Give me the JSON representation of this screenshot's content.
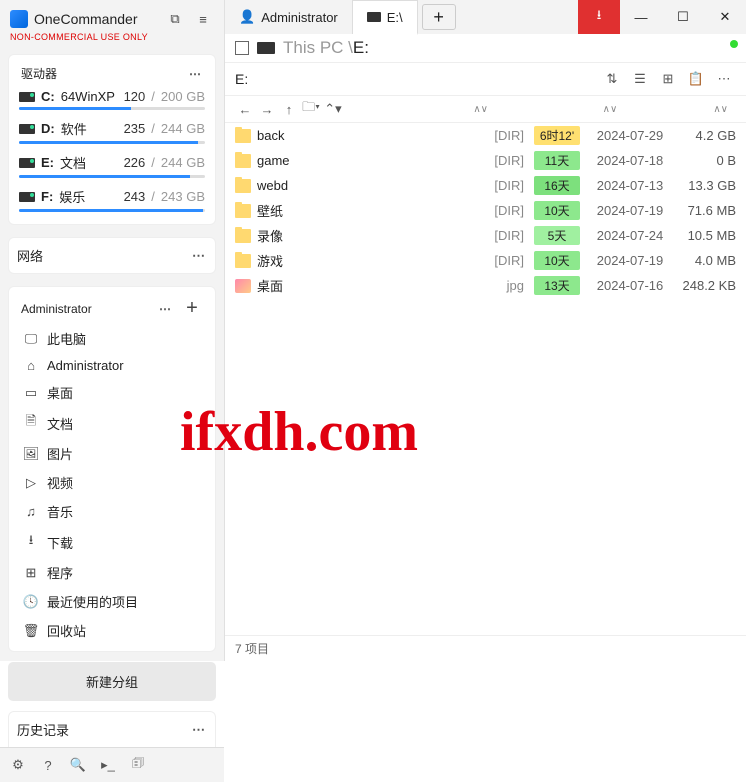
{
  "app": {
    "name": "OneCommander",
    "edition": "NON-COMMERCIAL USE ONLY"
  },
  "sidebar": {
    "drives_label": "驱动器",
    "drives": [
      {
        "letter": "C:",
        "name": "64WinXP",
        "used": "120",
        "total": "200 GB",
        "pct": 60
      },
      {
        "letter": "D:",
        "name": "软件",
        "used": "235",
        "total": "244 GB",
        "pct": 96
      },
      {
        "letter": "E:",
        "name": "文档",
        "used": "226",
        "total": "244 GB",
        "pct": 92
      },
      {
        "letter": "F:",
        "name": "娱乐",
        "used": "243",
        "total": "243 GB",
        "pct": 99
      }
    ],
    "network_label": "网络",
    "admin_label": "Administrator",
    "nav": [
      {
        "icon": "🖵",
        "label": "此电脑"
      },
      {
        "icon": "⌂",
        "label": "Administrator"
      },
      {
        "icon": "▭",
        "label": "桌面"
      },
      {
        "icon": "🗎",
        "label": "文档"
      },
      {
        "icon": "🖼",
        "label": "图片"
      },
      {
        "icon": "▷",
        "label": "视频"
      },
      {
        "icon": "♫",
        "label": "音乐"
      },
      {
        "icon": "⭳",
        "label": "下载"
      },
      {
        "icon": "⊞",
        "label": "程序"
      },
      {
        "icon": "🕓",
        "label": "最近使用的项目"
      },
      {
        "icon": "🗑",
        "label": "回收站"
      }
    ],
    "new_group": "新建分组",
    "history_label": "历史记录"
  },
  "tabs": [
    {
      "label": "Administrator",
      "active": false,
      "person": true
    },
    {
      "label": "E:\\",
      "active": true,
      "person": false
    }
  ],
  "path": {
    "prefix": "This PC \\",
    "current": "E:"
  },
  "location": "E:",
  "files": [
    {
      "name": "back",
      "type": "[DIR]",
      "age": "6时12'",
      "age_bg": "#ffe070",
      "date": "2024-07-29",
      "size": "4.2 GB",
      "folder": true
    },
    {
      "name": "game",
      "type": "[DIR]",
      "age": "11天",
      "age_bg": "#8de88d",
      "date": "2024-07-18",
      "size": "0 B",
      "folder": true
    },
    {
      "name": "webd",
      "type": "[DIR]",
      "age": "16天",
      "age_bg": "#7de07d",
      "date": "2024-07-13",
      "size": "13.3 GB",
      "folder": true
    },
    {
      "name": "壁纸",
      "type": "[DIR]",
      "age": "10天",
      "age_bg": "#8de88d",
      "date": "2024-07-19",
      "size": "71.6 MB",
      "folder": true
    },
    {
      "name": "录像",
      "type": "[DIR]",
      "age": "5天",
      "age_bg": "#a0f0a0",
      "date": "2024-07-24",
      "size": "10.5 MB",
      "folder": true
    },
    {
      "name": "游戏",
      "type": "[DIR]",
      "age": "10天",
      "age_bg": "#8de88d",
      "date": "2024-07-19",
      "size": "4.0 MB",
      "folder": true
    },
    {
      "name": "桌面",
      "type": "jpg",
      "age": "13天",
      "age_bg": "#8de88d",
      "date": "2024-07-16",
      "size": "248.2 KB",
      "folder": false
    }
  ],
  "status": {
    "count": "7 项目"
  },
  "watermark": "ifxdh.com"
}
